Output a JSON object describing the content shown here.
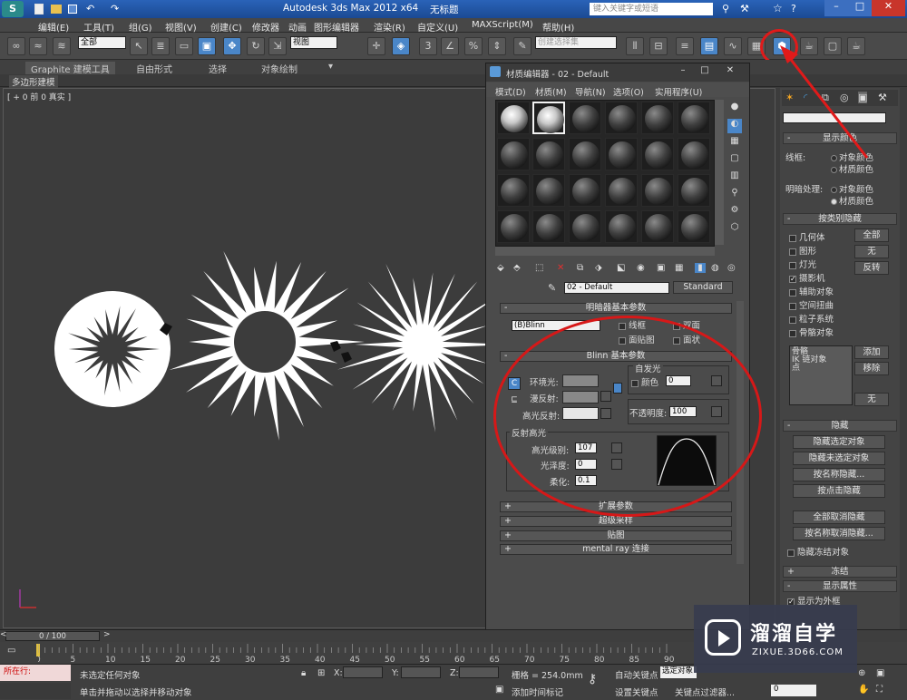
{
  "titlebar": {
    "title": "Autodesk 3ds Max  2012 x64",
    "file": "无标题",
    "search_placeholder": "键入关键字或短语"
  },
  "menubar": [
    "编辑(E)",
    "工具(T)",
    "组(G)",
    "视图(V)",
    "创建(C)",
    "修改器",
    "动画",
    "图形编辑器",
    "渲染(R)",
    "自定义(U)",
    "MAXScript(M)",
    "帮助(H)"
  ],
  "toolbar": {
    "selection_filter": "全部",
    "ref_coord": "视图",
    "named_selection": "创建选择集"
  },
  "ribbon": {
    "tabs": [
      "Graphite 建模工具",
      "自由形式",
      "选择",
      "对象绘制"
    ],
    "sub_tab": "多边形建模"
  },
  "viewport": {
    "label": "[ + 0 前 0 真实 ]"
  },
  "material_editor": {
    "title": "材质编辑器 - 02 - Default",
    "menus": [
      "模式(D)",
      "材质(M)",
      "导航(N)",
      "选项(O)",
      "实用程序(U)"
    ],
    "material_name": "02 - Default",
    "material_type": "Standard",
    "shader_rollout": "明暗器基本参数",
    "shader": "(B)Blinn",
    "shader_checks": [
      "线框",
      "双面",
      "面贴图",
      "面状"
    ],
    "blinn_rollout": "Blinn 基本参数",
    "self_illum": "自发光",
    "color_label": "颜色",
    "color_value": "0",
    "ambient": "环境光:",
    "diffuse": "漫反射:",
    "specular": "高光反射:",
    "opacity_label": "不透明度:",
    "opacity": "100",
    "spec_highlights": "反射高光",
    "spec_level_label": "高光级别:",
    "spec_level": "107",
    "gloss_label": "光泽度:",
    "gloss": "0",
    "soften_label": "柔化:",
    "soften": "0.1",
    "rollouts": [
      "扩展参数",
      "超级采样",
      "贴图",
      "mental ray 连接"
    ],
    "accent": "#cc1e1e"
  },
  "command_panel": {
    "display_color": "显示颜色",
    "wireframe": "线框:",
    "shaded": "明暗处理:",
    "object_color": "对象颜色",
    "material_color": "材质颜色",
    "hide_by_category": "按类别隐藏",
    "categories": [
      "几何体",
      "图形",
      "灯光",
      "摄影机",
      "辅助对象",
      "空间扭曲",
      "粒子系统",
      "骨骼对象"
    ],
    "all": "全部",
    "none": "无",
    "invert": "反转",
    "list": [
      "骨骼",
      "IK 链对象",
      "点"
    ],
    "add": "添加",
    "remove": "移除",
    "none2": "无",
    "hide": "隐藏",
    "hide_buttons": [
      "隐藏选定对象",
      "隐藏未选定对象",
      "按名称隐藏...",
      "按点击隐藏",
      "全部取消隐藏",
      "按名称取消隐藏...",
      "隐藏冻结对象"
    ],
    "freeze": "冻结",
    "display_props": "显示属性",
    "display_as_box": "显示为外框"
  },
  "timeline": {
    "frame": "0 / 100",
    "ticks": [
      "0",
      "5",
      "10",
      "15",
      "20",
      "25",
      "30",
      "35",
      "40",
      "45",
      "50",
      "55",
      "60",
      "65",
      "70",
      "75",
      "80",
      "85",
      "90"
    ]
  },
  "statusbar": {
    "running": "所在行:",
    "status1": "未选定任何对象",
    "status2": "单击并拖动以选择并移动对象",
    "x": "X:",
    "y": "Y:",
    "z": "Z:",
    "grid": "栅格 = 254.0mm",
    "add_time_tag": "添加时间标记",
    "auto_key": "自动关键点",
    "auto_key_sel": "选定对象",
    "set_key": "设置关键点",
    "key_filters": "关键点过滤器...",
    "frame_value": "0"
  },
  "watermark": {
    "brand": "溜溜自学",
    "url": "ZIXUE.3D66.COM"
  }
}
